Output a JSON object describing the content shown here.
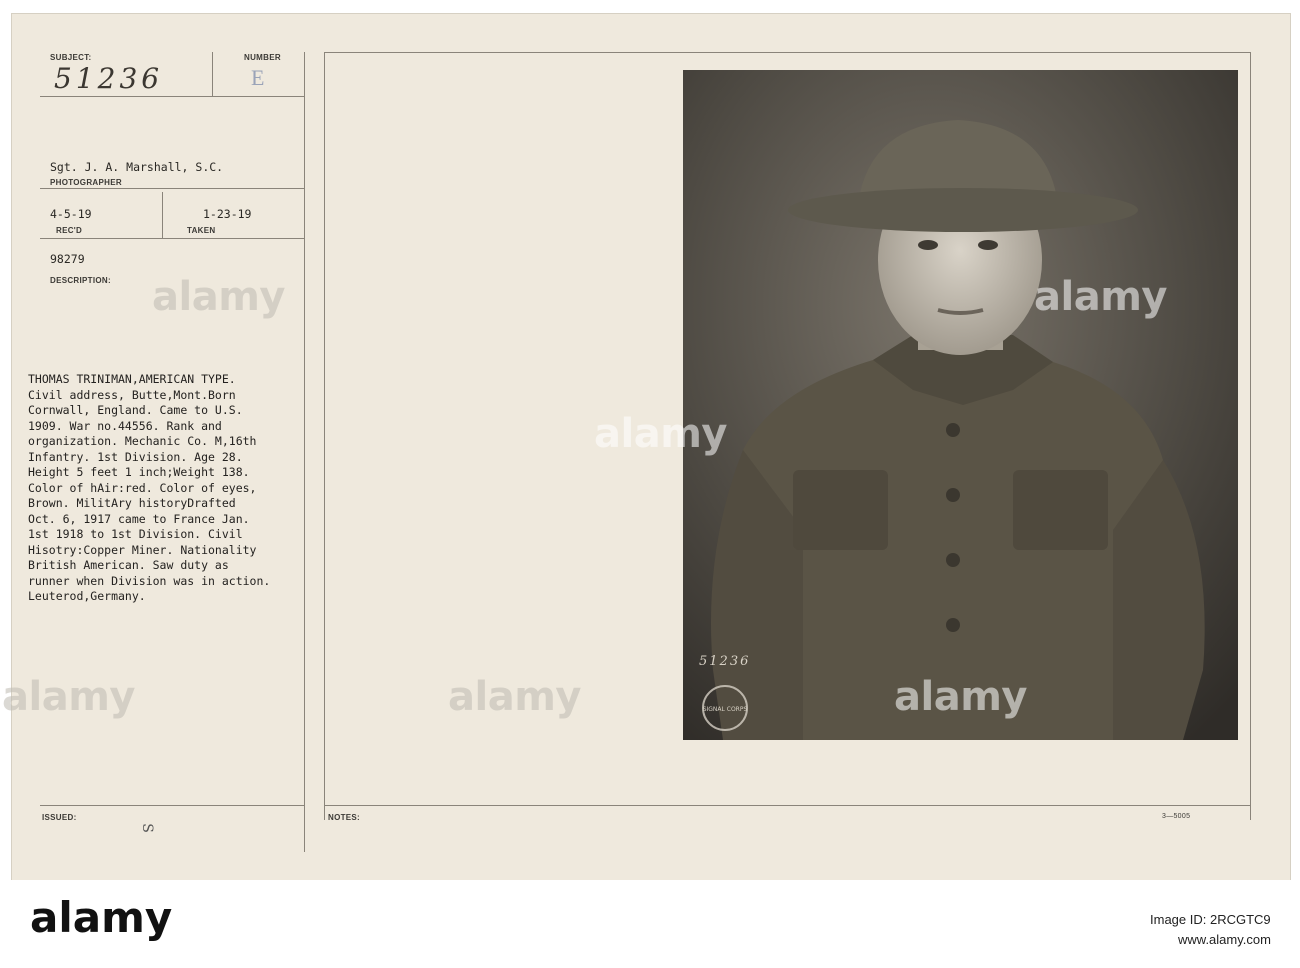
{
  "card": {
    "subject_label": "SUBJECT:",
    "subject_number": "51236",
    "number_label": "NUMBER",
    "number_value": "E",
    "photographer": "Sgt. J. A. Marshall, S.C.",
    "photographer_label": "PHOTOGRAPHER",
    "received_date": "4-5-19",
    "received_label": "REC'D",
    "taken_date": "1-23-19",
    "taken_label": "TAKEN",
    "file_number": "98279",
    "description_label": "DESCRIPTION:",
    "description_lines": [
      "THOMAS TRINIMAN,AMERICAN TYPE.",
      "Civil address, Butte,Mont.Born",
      "Cornwall, England. Came to U.S.",
      "1909. War no.44556. Rank and",
      "organization. Mechanic Co. M,16th",
      "Infantry. 1st Division. Age 28.",
      "Height 5 feet 1 inch;Weight 138.",
      "Color of hAir:red. Color of eyes,",
      "Brown. MilitAry historyDrafted",
      "Oct. 6, 1917 came to France Jan.",
      "1st 1918 to 1st Division. Civil",
      "Hisotry:Copper Miner. Nationality",
      "British American. Saw duty as",
      "runner when Division was in action.",
      "Leuterod,Germany."
    ],
    "issued_label": "ISSUED:",
    "issued_mark": "S",
    "notes_label": "NOTES:",
    "form_number": "3—5005",
    "photo_inscription": "51236",
    "stamp_text": "SIGNAL CORPS"
  },
  "watermarks": [
    "alamy",
    "alamy",
    "alamy",
    "alamy",
    "alamy",
    "alamy"
  ],
  "footer": {
    "logo": "alamy",
    "image_id_label": "Image ID: 2RCGTC9",
    "url": "www.alamy.com"
  },
  "colors": {
    "card": "#efe9dd",
    "photo_background": "#4a463f",
    "uniform": "#5a5446"
  }
}
